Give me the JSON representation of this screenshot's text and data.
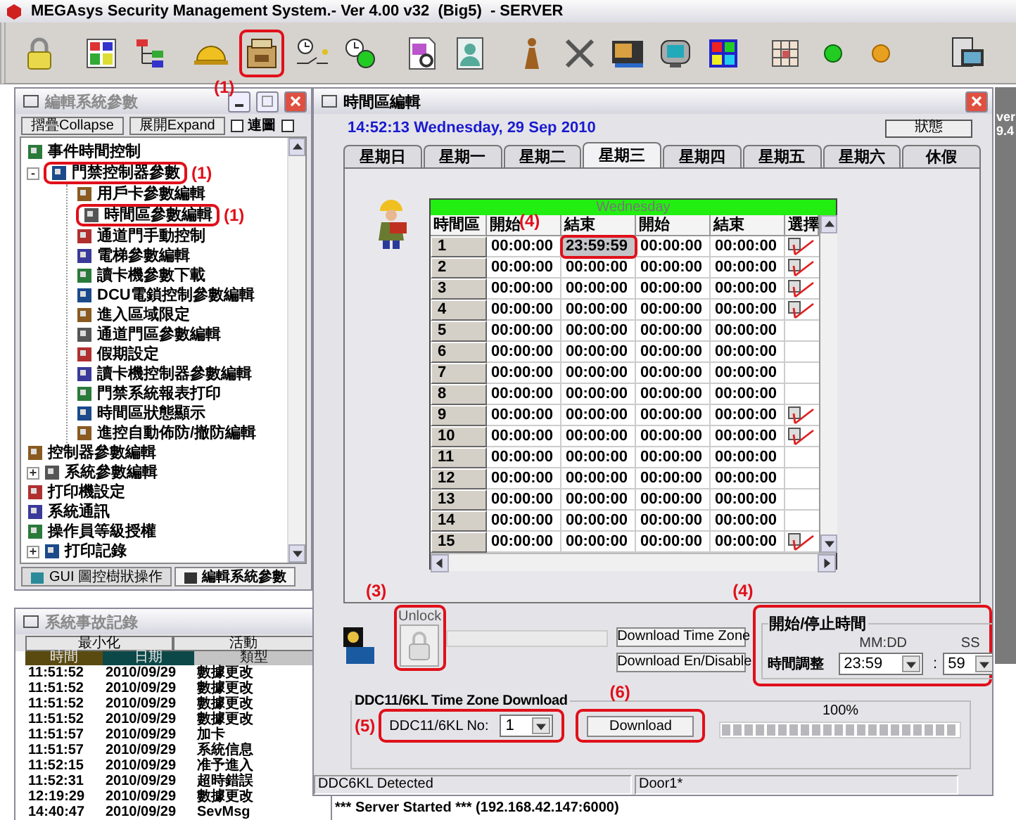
{
  "app_title": "MEGAsys Security Management System.- Ver 4.00 v32  (Big5)  - SERVER",
  "toolbar": {
    "groups": [
      [
        {
          "kind": "padlock"
        }
      ],
      [
        {
          "kind": "floor-plan"
        },
        {
          "kind": "org-chart"
        }
      ],
      [
        {
          "kind": "helmet"
        },
        {
          "kind": "cabinet",
          "annotation": "(1)"
        },
        {
          "kind": "switch"
        },
        {
          "kind": "clock"
        }
      ],
      [
        {
          "kind": "report"
        },
        {
          "kind": "person-card"
        }
      ],
      [
        {
          "kind": "figure"
        },
        {
          "kind": "tools"
        },
        {
          "kind": "monitor"
        },
        {
          "kind": "display"
        },
        {
          "kind": "palette"
        }
      ],
      [
        {
          "kind": "grid"
        },
        {
          "kind": "green-light"
        },
        {
          "kind": "orange-light"
        }
      ],
      [
        {
          "kind": "computer"
        }
      ]
    ]
  },
  "side_panel": {
    "lines": [
      "ver",
      "9.4"
    ]
  },
  "params_window": {
    "title": "編輯系統參數",
    "buttons": [
      "摺疊Collapse",
      "展開Expand"
    ],
    "checkboxes": [
      {
        "label": "連圖",
        "checked": false
      },
      {
        "checked": false
      }
    ],
    "tree": [
      {
        "label": "事件時間控制"
      },
      {
        "label": "門禁控制器參數",
        "toggle": "-",
        "annotation": "(1)",
        "children": [
          {
            "label": "用戶卡參數編輯"
          },
          {
            "label": "時間區參數編輯",
            "annotation": "(1)"
          },
          {
            "label": "通道門手動控制"
          },
          {
            "label": "電梯參數編輯"
          },
          {
            "label": "讀卡機參數下載"
          },
          {
            "label": "DCU電鎖控制參數編輯"
          },
          {
            "label": "進入區域限定"
          },
          {
            "label": "通道門區參數編輯"
          },
          {
            "label": "假期設定"
          },
          {
            "label": "讀卡機控制器參數編輯"
          },
          {
            "label": "門禁系統報表打印"
          },
          {
            "label": "時間區狀態顯示"
          },
          {
            "label": "進控自動佈防/撤防編輯"
          }
        ]
      },
      {
        "label": "控制器參數編輯"
      },
      {
        "label": "系統參數編輯",
        "toggle": "+"
      },
      {
        "label": "打印機設定"
      },
      {
        "label": "系統通訊"
      },
      {
        "label": "操作員等級授權"
      },
      {
        "label": "打印記錄",
        "toggle": "+"
      }
    ],
    "bottom_tabs": [
      {
        "label": "GUI 圖控樹狀操作",
        "selected": false
      },
      {
        "label": "編輯系統參數",
        "selected": true
      }
    ]
  },
  "log_window": {
    "title": "系統事故記錄",
    "buttons": [
      "最小化",
      "活動"
    ],
    "columns": [
      {
        "label": "時間",
        "color": "#5a4a10"
      },
      {
        "label": "日期",
        "color": "#0d4848"
      },
      {
        "label": "類型",
        "color": "#c4c4c4"
      }
    ],
    "rows": [
      [
        "11:51:52",
        "2010/09/29",
        "數據更改"
      ],
      [
        "11:51:52",
        "2010/09/29",
        "數據更改"
      ],
      [
        "11:51:52",
        "2010/09/29",
        "數據更改"
      ],
      [
        "11:51:52",
        "2010/09/29",
        "數據更改"
      ],
      [
        "11:51:57",
        "2010/09/29",
        "加卡"
      ],
      [
        "11:51:57",
        "2010/09/29",
        "系統信息"
      ],
      [
        "11:52:15",
        "2010/09/29",
        "准予進入"
      ],
      [
        "11:52:31",
        "2010/09/29",
        "超時錯誤"
      ],
      [
        "12:19:29",
        "2010/09/29",
        "數據更改"
      ],
      [
        "14:40:47",
        "2010/09/29",
        "SevMsg"
      ]
    ]
  },
  "main_window": {
    "title": "時間區編輯",
    "clock": "14:52:13 Wednesday, 29 Sep 2010",
    "status_button": "狀態",
    "tabs": [
      {
        "label": "星期日",
        "selected": false
      },
      {
        "label": "星期一",
        "selected": false
      },
      {
        "label": "星期二",
        "selected": false
      },
      {
        "label": "星期三",
        "selected": true
      },
      {
        "label": "星期四",
        "selected": false
      },
      {
        "label": "星期五",
        "selected": false
      },
      {
        "label": "星期六",
        "selected": false
      },
      {
        "label": "休假",
        "selected": false
      }
    ],
    "table": {
      "caption": "Wednesday",
      "columns": [
        "時間區",
        "開始",
        "結束",
        "開始",
        "結束",
        "選擇"
      ],
      "rows": [
        {
          "checked": true,
          "cells": [
            {
              "kind": "zone",
              "text": "1"
            },
            {
              "kind": "time",
              "text": "00:00:00",
              "focused": false
            },
            {
              "kind": "time",
              "text": "23:59:59",
              "focused": true,
              "annotation": "(4)"
            },
            {
              "kind": "time",
              "text": "00:00:00",
              "focused": false
            },
            {
              "kind": "time",
              "text": "00:00:00",
              "focused": false
            }
          ]
        },
        {
          "checked": true,
          "cells": [
            {
              "kind": "zone",
              "text": "2"
            },
            {
              "kind": "time",
              "text": "00:00:00",
              "focused": false
            },
            {
              "kind": "time",
              "text": "00:00:00",
              "focused": false
            },
            {
              "kind": "time",
              "text": "00:00:00",
              "focused": false
            },
            {
              "kind": "time",
              "text": "00:00:00",
              "focused": false
            }
          ]
        },
        {
          "checked": true,
          "cells": [
            {
              "kind": "zone",
              "text": "3"
            },
            {
              "kind": "time",
              "text": "00:00:00",
              "focused": false
            },
            {
              "kind": "time",
              "text": "00:00:00",
              "focused": false
            },
            {
              "kind": "time",
              "text": "00:00:00",
              "focused": false
            },
            {
              "kind": "time",
              "text": "00:00:00",
              "focused": false
            }
          ]
        },
        {
          "checked": true,
          "cells": [
            {
              "kind": "zone",
              "text": "4"
            },
            {
              "kind": "time",
              "text": "00:00:00",
              "focused": false
            },
            {
              "kind": "time",
              "text": "00:00:00",
              "focused": false
            },
            {
              "kind": "time",
              "text": "00:00:00",
              "focused": false
            },
            {
              "kind": "time",
              "text": "00:00:00",
              "focused": false
            }
          ]
        },
        {
          "checked": false,
          "cells": [
            {
              "kind": "zone",
              "text": "5"
            },
            {
              "kind": "time",
              "text": "00:00:00",
              "focused": false
            },
            {
              "kind": "time",
              "text": "00:00:00",
              "focused": false
            },
            {
              "kind": "time",
              "text": "00:00:00",
              "focused": false
            },
            {
              "kind": "time",
              "text": "00:00:00",
              "focused": false
            }
          ]
        },
        {
          "checked": false,
          "cells": [
            {
              "kind": "zone",
              "text": "6"
            },
            {
              "kind": "time",
              "text": "00:00:00",
              "focused": false
            },
            {
              "kind": "time",
              "text": "00:00:00",
              "focused": false
            },
            {
              "kind": "time",
              "text": "00:00:00",
              "focused": false
            },
            {
              "kind": "time",
              "text": "00:00:00",
              "focused": false
            }
          ]
        },
        {
          "checked": false,
          "cells": [
            {
              "kind": "zone",
              "text": "7"
            },
            {
              "kind": "time",
              "text": "00:00:00",
              "focused": false
            },
            {
              "kind": "time",
              "text": "00:00:00",
              "focused": false
            },
            {
              "kind": "time",
              "text": "00:00:00",
              "focused": false
            },
            {
              "kind": "time",
              "text": "00:00:00",
              "focused": false
            }
          ]
        },
        {
          "checked": false,
          "cells": [
            {
              "kind": "zone",
              "text": "8"
            },
            {
              "kind": "time",
              "text": "00:00:00",
              "focused": false
            },
            {
              "kind": "time",
              "text": "00:00:00",
              "focused": false
            },
            {
              "kind": "time",
              "text": "00:00:00",
              "focused": false
            },
            {
              "kind": "time",
              "text": "00:00:00",
              "focused": false
            }
          ]
        },
        {
          "checked": true,
          "cells": [
            {
              "kind": "zone",
              "text": "9"
            },
            {
              "kind": "time",
              "text": "00:00:00",
              "focused": false
            },
            {
              "kind": "time",
              "text": "00:00:00",
              "focused": false
            },
            {
              "kind": "time",
              "text": "00:00:00",
              "focused": false
            },
            {
              "kind": "time",
              "text": "00:00:00",
              "focused": false
            }
          ]
        },
        {
          "checked": true,
          "cells": [
            {
              "kind": "zone",
              "text": "10"
            },
            {
              "kind": "time",
              "text": "00:00:00",
              "focused": false
            },
            {
              "kind": "time",
              "text": "00:00:00",
              "focused": false
            },
            {
              "kind": "time",
              "text": "00:00:00",
              "focused": false
            },
            {
              "kind": "time",
              "text": "00:00:00",
              "focused": false
            }
          ]
        },
        {
          "checked": false,
          "cells": [
            {
              "kind": "zone",
              "text": "11"
            },
            {
              "kind": "time",
              "text": "00:00:00",
              "focused": false
            },
            {
              "kind": "time",
              "text": "00:00:00",
              "focused": false
            },
            {
              "kind": "time",
              "text": "00:00:00",
              "focused": false
            },
            {
              "kind": "time",
              "text": "00:00:00",
              "focused": false
            }
          ]
        },
        {
          "checked": false,
          "cells": [
            {
              "kind": "zone",
              "text": "12"
            },
            {
              "kind": "time",
              "text": "00:00:00",
              "focused": false
            },
            {
              "kind": "time",
              "text": "00:00:00",
              "focused": false
            },
            {
              "kind": "time",
              "text": "00:00:00",
              "focused": false
            },
            {
              "kind": "time",
              "text": "00:00:00",
              "focused": false
            }
          ]
        },
        {
          "checked": false,
          "cells": [
            {
              "kind": "zone",
              "text": "13"
            },
            {
              "kind": "time",
              "text": "00:00:00",
              "focused": false
            },
            {
              "kind": "time",
              "text": "00:00:00",
              "focused": false
            },
            {
              "kind": "time",
              "text": "00:00:00",
              "focused": false
            },
            {
              "kind": "time",
              "text": "00:00:00",
              "focused": false
            }
          ]
        },
        {
          "checked": false,
          "cells": [
            {
              "kind": "zone",
              "text": "14"
            },
            {
              "kind": "time",
              "text": "00:00:00",
              "focused": false
            },
            {
              "kind": "time",
              "text": "00:00:00",
              "focused": false
            },
            {
              "kind": "time",
              "text": "00:00:00",
              "focused": false
            },
            {
              "kind": "time",
              "text": "00:00:00",
              "focused": false
            }
          ]
        },
        {
          "checked": true,
          "cells": [
            {
              "kind": "zone",
              "text": "15"
            },
            {
              "kind": "time",
              "text": "00:00:00",
              "focused": false
            },
            {
              "kind": "time",
              "text": "00:00:00",
              "focused": false
            },
            {
              "kind": "time",
              "text": "00:00:00",
              "focused": false
            },
            {
              "kind": "time",
              "text": "00:00:00",
              "focused": false
            }
          ]
        }
      ]
    },
    "unlock": {
      "label": "Unlock",
      "annotation": "(3)"
    },
    "download_buttons": [
      "Download Time Zone",
      "Download En/Disable"
    ],
    "time_group": {
      "title": "開始/停止時間",
      "annotation": "(4)",
      "mmdd_label": "MM:DD",
      "ss_label": "SS",
      "adjust_label": "時間調整",
      "mmdd_value": "23:59",
      "separator": ":",
      "ss_value": "59"
    },
    "ddc": {
      "title": "DDC11/6KL Time Zone Download",
      "no_label": "DDC11/6KL No:",
      "no_value": "1",
      "no_annotation": "(5)",
      "download": "Download",
      "download_annotation": "(6)",
      "progress_text": "100%",
      "level": 1
    },
    "status_bar": [
      "DDC6KL Detected",
      "Door1*"
    ]
  },
  "server_line": "*** Server Started *** (192.168.42.147:6000)"
}
